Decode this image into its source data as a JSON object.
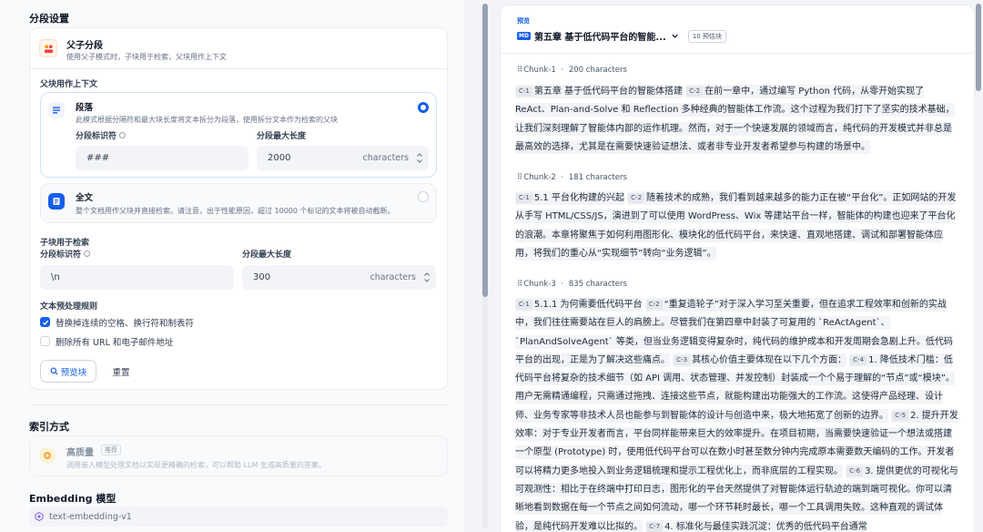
{
  "segment_settings": {
    "title": "分段设置",
    "parent_child": {
      "title": "父子分段",
      "desc": "使用父子模式时，子块用于检索，父块用作上下文"
    },
    "parent_section_title": "父块用作上下文",
    "paragraph": {
      "title": "段落",
      "desc": "此模式根据分隔符和最大块长度将文本拆分为段落，使用拆分文本作为检索的父块",
      "identifier_label": "分段标识符",
      "identifier_value": "###",
      "max_length_label": "分段最大长度",
      "max_length_value": "2000",
      "unit": "characters"
    },
    "fulltext": {
      "title": "全文",
      "desc": "整个文档用作父块并直接检索。请注意，出于性能原因，超过 10000 个标记的文本将被自动截断。"
    },
    "child": {
      "title": "子块用于检索",
      "identifier_label": "分段标识符",
      "identifier_value": "\\n",
      "max_length_label": "分段最大长度",
      "max_length_value": "300",
      "unit": "characters"
    },
    "preprocess": {
      "title": "文本预处理规则",
      "rule1": "替换掉连续的空格、换行符和制表符",
      "rule2": "删除所有 URL 和电子邮件地址"
    },
    "preview_button": "预览块",
    "reset_button": "重置"
  },
  "index": {
    "title": "索引方式",
    "high_quality": "高质量",
    "recommended": "推荐",
    "desc": "调用嵌入模型处理文档以实现更精确的检索，可以帮助 LLM 生成高质量的答案。"
  },
  "embedding": {
    "title": "Embedding 模型",
    "model": "text-embedding-v1"
  },
  "preview": {
    "label": "预览",
    "doc_badge": "MD",
    "doc_title": "第五章 基于低代码平台的智能...",
    "count": "10 预估块",
    "chunks": [
      {
        "name": "Chunk-1",
        "chars": "200 characters",
        "segments": [
          {
            "tag": "C-1",
            "text": "第五章 基于低代码平台的智能体搭建"
          },
          {
            "tag": "C-2",
            "text": "在前一章中，通过编写 Python 代码，从零开始实现了 ReAct、Plan-and-Solve 和 Reflection 多种经典的智能体工作流。这个过程为我们打下了坚实的技术基础，让我们深刻理解了智能体内部的运作机理。然而，对于一个快速发展的领域而言，纯代码的开发模式并非总是最高效的选择，尤其是在需要快速验证想法、或者非专业开发者希望参与构建的场景中。"
          }
        ]
      },
      {
        "name": "Chunk-2",
        "chars": "181 characters",
        "segments": [
          {
            "tag": "C-1",
            "text": "5.1 平台化构建的兴起"
          },
          {
            "tag": "C-2",
            "text": "随着技术的成熟，我们看到越来越多的能力正在被“平台化”。正如网站的开发从手写 HTML/CSS/JS，演进到了可以使用 WordPress、Wix 等建站平台一样，智能体的构建也迎来了平台化的浪潮。本章将聚焦于如何利用图形化、模块化的低代码平台，来快速、直观地搭建、调试和部署智能体应用，将我们的重心从“实现细节”转向“业务逻辑”。"
          }
        ]
      },
      {
        "name": "Chunk-3",
        "chars": "835 characters",
        "segments": [
          {
            "tag": "C-1",
            "text": "5.1.1 为何需要低代码平台"
          },
          {
            "tag": "C-2",
            "text": "“重复造轮子”对于深入学习至关重要，但在追求工程效率和创新的实战中，我们往往需要站在巨人的肩膀上。尽管我们在第四章中封装了可复用的 `ReActAgent`、`PlanAndSolveAgent` 等类，但当业务逻辑变得复杂时，纯代码的维护成本和开发周期会急剧上升。低代码平台的出现，正是为了解决这些痛点。"
          },
          {
            "tag": "C-3",
            "text": "其核心价值主要体现在以下几个方面："
          },
          {
            "tag": "C-4",
            "text": "1. 降低技术门槛：低代码平台将复杂的技术细节（如 API 调用、状态管理、并发控制）封装成一个个易于理解的“节点”或“模块”。用户无需精通编程，只需通过拖拽、连接这些节点，就能构建出功能强大的工作流。这使得产品经理、设计师、业务专家等非技术人员也能参与到智能体的设计与创造中来，极大地拓宽了创新的边界。"
          },
          {
            "tag": "C-5",
            "text": "2. 提升开发效率：对于专业开发者而言，平台同样能带来巨大的效率提升。在项目初期，当需要快速验证一个想法或搭建一个原型 (Prototype) 时，使用低代码平台可以在数小时甚至数分钟内完成原本需要数天编码的工作。开发者可以将精力更多地投入到业务逻辑梳理和提示工程优化上，而非底层的工程实现。"
          },
          {
            "tag": "C-6",
            "text": "3. 提供更优的可视化与可观测性：相比于在终端中打印日志，图形化的平台天然提供了对智能体运行轨迹的端到端可视化。你可以清晰地看到数据在每一个节点之间如何流动，哪一个环节耗时最长，哪一个工具调用失败。这种直观的调试体验，是纯代码开发难以比拟的。"
          },
          {
            "tag": "C-7",
            "text": "4. 标准化与最佳实践沉淀：优秀的低代码平台通常"
          }
        ]
      }
    ]
  },
  "colors": {
    "primary": "#155eef",
    "orange": "#f04438"
  }
}
